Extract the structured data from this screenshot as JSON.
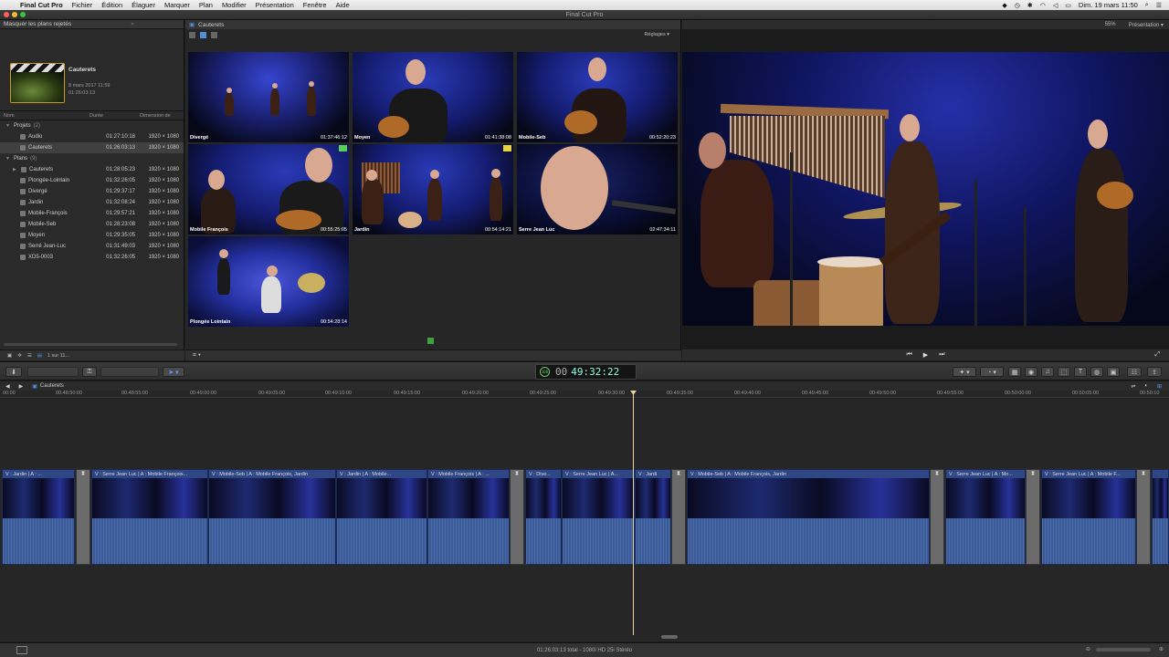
{
  "menubar": {
    "app": "Final Cut Pro",
    "items": [
      "Fichier",
      "Édition",
      "Élaguer",
      "Marquer",
      "Plan",
      "Modifier",
      "Présentation",
      "Fenêtre",
      "Aide"
    ],
    "clock": "Dim. 19 mars  11:50"
  },
  "window": {
    "title": "Final Cut Pro"
  },
  "library": {
    "filter": "Masquer les plans rejetés",
    "event": {
      "title": "Cauterets",
      "date": "8 mars 2017 11:59",
      "duration": "01:26:03:13"
    },
    "columns": [
      "Nom",
      "Durée",
      "Dimension de"
    ],
    "projects_label": "Projets",
    "projects_count": "(2)",
    "projects": [
      {
        "name": "Audio",
        "duration": "01:27:10:18",
        "dim": "1920 × 1080"
      },
      {
        "name": "Cauterets",
        "duration": "01:26:03:13",
        "dim": "1920 × 1080"
      }
    ],
    "plans_label": "Plans",
    "plans_count": "(9)",
    "plans": [
      {
        "name": "Cauterets",
        "duration": "01:28:05:23",
        "dim": "1920 × 1080"
      },
      {
        "name": "Plongée-Lointain",
        "duration": "01:32:26:05",
        "dim": "1920 × 1080"
      },
      {
        "name": "Divergé",
        "duration": "01:29:37:17",
        "dim": "1920 × 1080"
      },
      {
        "name": "Jardin",
        "duration": "01:32:08:24",
        "dim": "1920 × 1080"
      },
      {
        "name": "Mobile-François",
        "duration": "01:29:57:21",
        "dim": "1920 × 1080"
      },
      {
        "name": "Mobile-Seb",
        "duration": "01:28:23:08",
        "dim": "1920 × 1080"
      },
      {
        "name": "Moyen",
        "duration": "01:29:35:05",
        "dim": "1920 × 1080"
      },
      {
        "name": "Serré Jean-Luc",
        "duration": "01:31:49:03",
        "dim": "1920 × 1080"
      },
      {
        "name": "XD5-0003",
        "duration": "01:32:26:05",
        "dim": "1920 × 1080"
      }
    ],
    "footer_count": "1 sur 11..."
  },
  "browser": {
    "title": "Cauterets",
    "settings_label": "Réglages",
    "clips": [
      {
        "name": "Divergé",
        "tc": "01:37:46:12"
      },
      {
        "name": "Moyen",
        "tc": "01:41:38:08"
      },
      {
        "name": "Mobile-Seb",
        "tc": "00:52:20:23"
      },
      {
        "name": "Mobile François",
        "tc": "00:55:25:05"
      },
      {
        "name": "Jardin",
        "tc": "00:54:14:21"
      },
      {
        "name": "Serre Jean Luc",
        "tc": "02:47:34:11"
      },
      {
        "name": "Plongée Lointain",
        "tc": "00:54:28:14"
      }
    ]
  },
  "viewer": {
    "zoom": "55%",
    "presentation": "Présentation"
  },
  "toolbar": {
    "timecode": "49:32:22",
    "timecode_prefix": "00",
    "gauge": "100"
  },
  "timeline": {
    "project": "Cauterets",
    "ruler": [
      "00:00",
      "00:48:50:00",
      "00:48:55:00",
      "00:49:00:00",
      "00:49:05:00",
      "00:49:10:00",
      "00:49:15:00",
      "00:49:20:00",
      "00:49:25:00",
      "00:49:30:00",
      "00:49:35:00",
      "00:49:40:00",
      "00:49:45:00",
      "00:49:50:00",
      "00:49:55:00",
      "00:50:00:00",
      "00:50:05:00",
      "00:50:10"
    ],
    "clips": [
      "V : Jardin | A : ...",
      "V : Serre Jean Luc | A : Mobile François...",
      "V : Mobile-Seb | A : Mobile François, Jardin",
      "V : Jardin | A : Mobile...",
      "V : Mobile François | A : ...",
      "V : Dive...",
      "V : Serre Jean Luc | A...",
      "V : Jardi",
      "V : Mobile-Seb | A : Mobile François, Jardin",
      "V : Serre Jean Luc | A : Mo...",
      "V : Serre Jean Luc | A : Mobile F..."
    ]
  },
  "status": "01:26:03:13 total - 1080i HD 25i Stéréo"
}
